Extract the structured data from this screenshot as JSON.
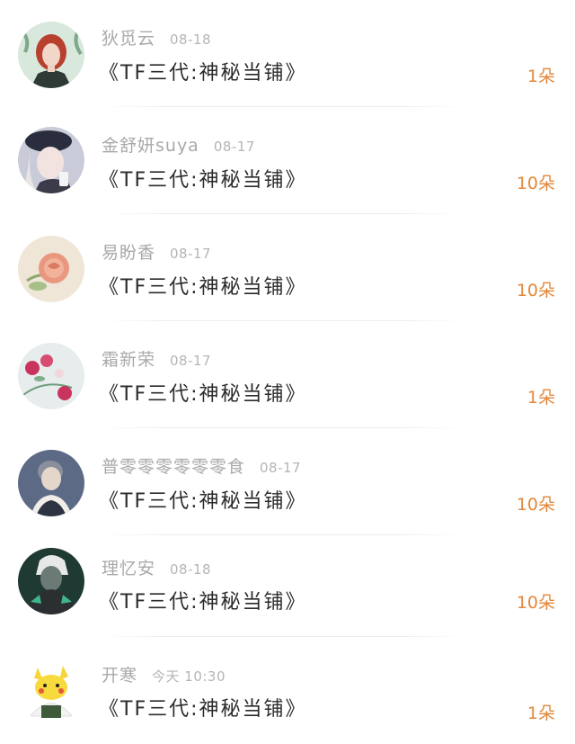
{
  "gifts": [
    {
      "name": "狄觅云",
      "date": "08-18",
      "title": "《TF三代:神秘当铺》",
      "count": "1朵",
      "avatar": "red-haired-girl-avatar"
    },
    {
      "name": "金舒妍suya",
      "date": "08-17",
      "title": "《TF三代:神秘当铺》",
      "count": "10朵",
      "avatar": "girl-with-beret-avatar"
    },
    {
      "name": "易盼香",
      "date": "08-17",
      "title": "《TF三代:神秘当铺》",
      "count": "10朵",
      "avatar": "pink-rose-avatar"
    },
    {
      "name": "霜新荣",
      "date": "08-17",
      "title": "《TF三代:神秘当铺》",
      "count": "1朵",
      "avatar": "flowers-avatar"
    },
    {
      "name": "普零零零零零零食",
      "date": "08-17",
      "title": "《TF三代:神秘当铺》",
      "count": "10朵",
      "avatar": "portrait-avatar"
    },
    {
      "name": "理忆安",
      "date": "08-18",
      "title": "《TF三代:神秘当铺》",
      "count": "10朵",
      "avatar": "dark-character-avatar"
    },
    {
      "name": "开寒",
      "date": "今天 10:30",
      "title": "《TF三代:神秘当铺》",
      "count": "1朵",
      "avatar": "pikachu-riceball-avatar"
    }
  ]
}
